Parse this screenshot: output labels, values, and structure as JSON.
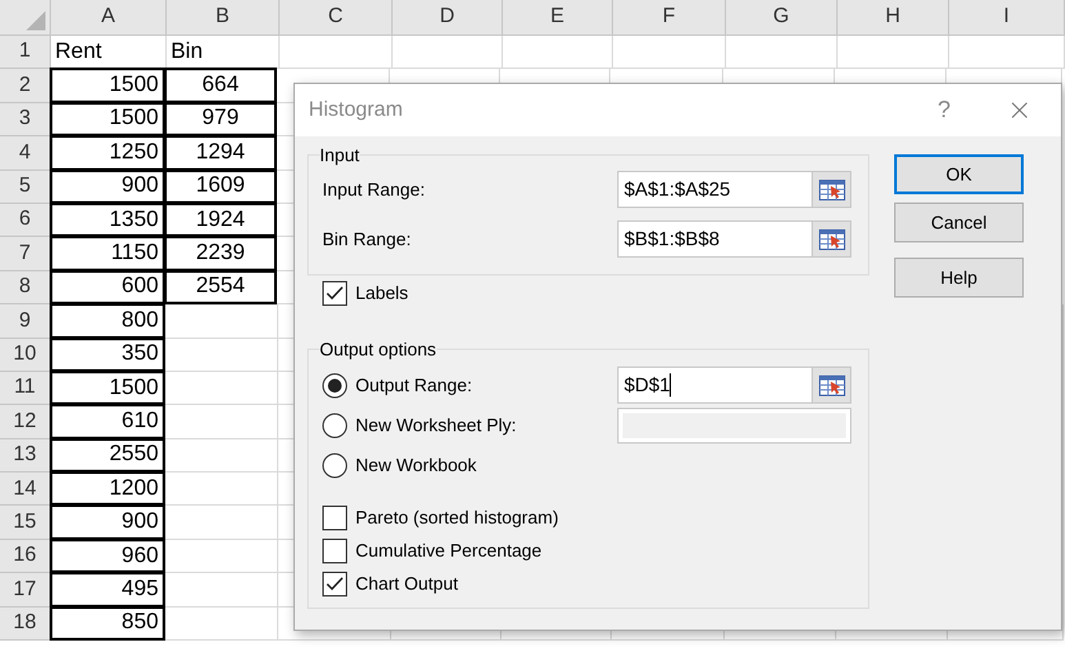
{
  "sheet": {
    "columns": [
      "A",
      "B",
      "C",
      "D",
      "E",
      "F",
      "G",
      "H",
      "I"
    ],
    "rows": [
      {
        "number": "1",
        "cells": [
          {
            "text": "Rent",
            "boxed": false
          },
          {
            "text": "Bin",
            "boxed": false
          }
        ]
      },
      {
        "number": "2",
        "cells": [
          {
            "text": "1500",
            "boxed": true
          },
          {
            "text": "664",
            "boxed": true
          }
        ]
      },
      {
        "number": "3",
        "cells": [
          {
            "text": "1500",
            "boxed": true
          },
          {
            "text": "979",
            "boxed": true
          }
        ]
      },
      {
        "number": "4",
        "cells": [
          {
            "text": "1250",
            "boxed": true
          },
          {
            "text": "1294",
            "boxed": true
          }
        ]
      },
      {
        "number": "5",
        "cells": [
          {
            "text": "900",
            "boxed": true
          },
          {
            "text": "1609",
            "boxed": true
          }
        ]
      },
      {
        "number": "6",
        "cells": [
          {
            "text": "1350",
            "boxed": true
          },
          {
            "text": "1924",
            "boxed": true
          }
        ]
      },
      {
        "number": "7",
        "cells": [
          {
            "text": "1150",
            "boxed": true
          },
          {
            "text": "2239",
            "boxed": true
          }
        ]
      },
      {
        "number": "8",
        "cells": [
          {
            "text": "600",
            "boxed": true
          },
          {
            "text": "2554",
            "boxed": true
          }
        ]
      },
      {
        "number": "9",
        "cells": [
          {
            "text": "800",
            "boxed": true
          }
        ]
      },
      {
        "number": "10",
        "cells": [
          {
            "text": "350",
            "boxed": true
          }
        ]
      },
      {
        "number": "11",
        "cells": [
          {
            "text": "1500",
            "boxed": true
          }
        ]
      },
      {
        "number": "12",
        "cells": [
          {
            "text": "610",
            "boxed": true
          }
        ]
      },
      {
        "number": "13",
        "cells": [
          {
            "text": "2550",
            "boxed": true
          }
        ]
      },
      {
        "number": "14",
        "cells": [
          {
            "text": "1200",
            "boxed": true
          }
        ]
      },
      {
        "number": "15",
        "cells": [
          {
            "text": "900",
            "boxed": true
          }
        ]
      },
      {
        "number": "16",
        "cells": [
          {
            "text": "960",
            "boxed": true
          }
        ]
      },
      {
        "number": "17",
        "cells": [
          {
            "text": "495",
            "boxed": true
          }
        ]
      },
      {
        "number": "18",
        "cells": [
          {
            "text": "850",
            "boxed": true
          }
        ]
      }
    ]
  },
  "dialog": {
    "title": "Histogram",
    "help": "?",
    "input_group": {
      "legend": "Input",
      "fields": [
        {
          "label": "Input Range:",
          "value": "$A$1:$A$25"
        },
        {
          "label": "Bin Range:",
          "value": "$B$1:$B$8"
        }
      ]
    },
    "labels_option": {
      "label": "Labels",
      "checked": true
    },
    "output_group": {
      "legend": "Output options",
      "options": [
        {
          "label": "Output Range:",
          "selected": true,
          "field": {
            "kind": "range",
            "value": "$D$1",
            "focused": true
          }
        },
        {
          "label": "New Worksheet Ply:",
          "selected": false,
          "field": {
            "kind": "disabled"
          }
        },
        {
          "label": "New Workbook",
          "selected": false
        }
      ],
      "checkboxes": [
        {
          "label": "Pareto (sorted histogram)",
          "checked": false
        },
        {
          "label": "Cumulative Percentage",
          "checked": false
        },
        {
          "label": "Chart Output",
          "checked": true
        }
      ]
    },
    "buttons": [
      {
        "label": "OK",
        "focused": true
      },
      {
        "label": "Cancel",
        "focused": false
      },
      {
        "label": "Help",
        "focused": false
      }
    ]
  }
}
